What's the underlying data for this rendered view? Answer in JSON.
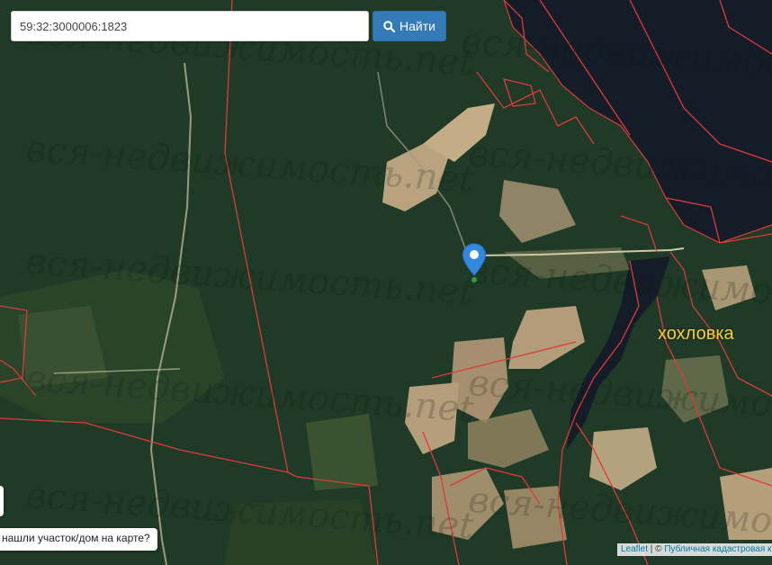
{
  "search": {
    "value": "59:32:3000006:1823",
    "button_label": "Найти",
    "button_icon": "search-icon"
  },
  "map": {
    "place_label": "хохловка",
    "watermark_text": "вся-недвижимость.net",
    "marker_icon": "map-pin-icon",
    "boundary_color": "#e0393a",
    "marker_color": "#3388e0"
  },
  "feedback": {
    "text": "нашли участок/дом на карте?"
  },
  "attribution": {
    "leaflet": "Leaflet",
    "separator": " | © ",
    "source": "Публичная кадастровая карта"
  }
}
